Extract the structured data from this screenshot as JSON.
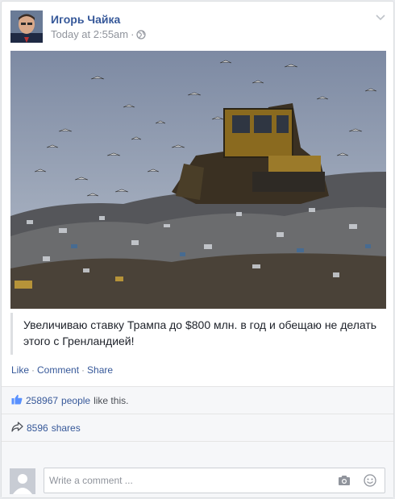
{
  "post": {
    "author": "Игорь Чайка",
    "timestamp": "Today at 2:55am",
    "separator": "·",
    "audience_icon": "globe-icon",
    "menu_icon": "chevron-down-icon",
    "quote_text": "Увеличиваю ставку Трампа до $800 млн. в год и обещаю не делать этого с Гренландией!",
    "photo_description_icon": "landfill-photo"
  },
  "actions": {
    "like": "Like",
    "comment": "Comment",
    "share": "Share",
    "dot": "·"
  },
  "reactions": {
    "count": "258967",
    "people": "people",
    "suffix": "like this."
  },
  "shares": {
    "count": "8596",
    "label": "shares"
  },
  "comment_box": {
    "placeholder": "Write a comment ...",
    "camera_icon": "camera-icon",
    "emoji_icon": "smile-icon"
  },
  "colors": {
    "link": "#365899",
    "meta": "#90949c",
    "section_bg": "#f6f7f9",
    "border": "#dddfe2"
  }
}
